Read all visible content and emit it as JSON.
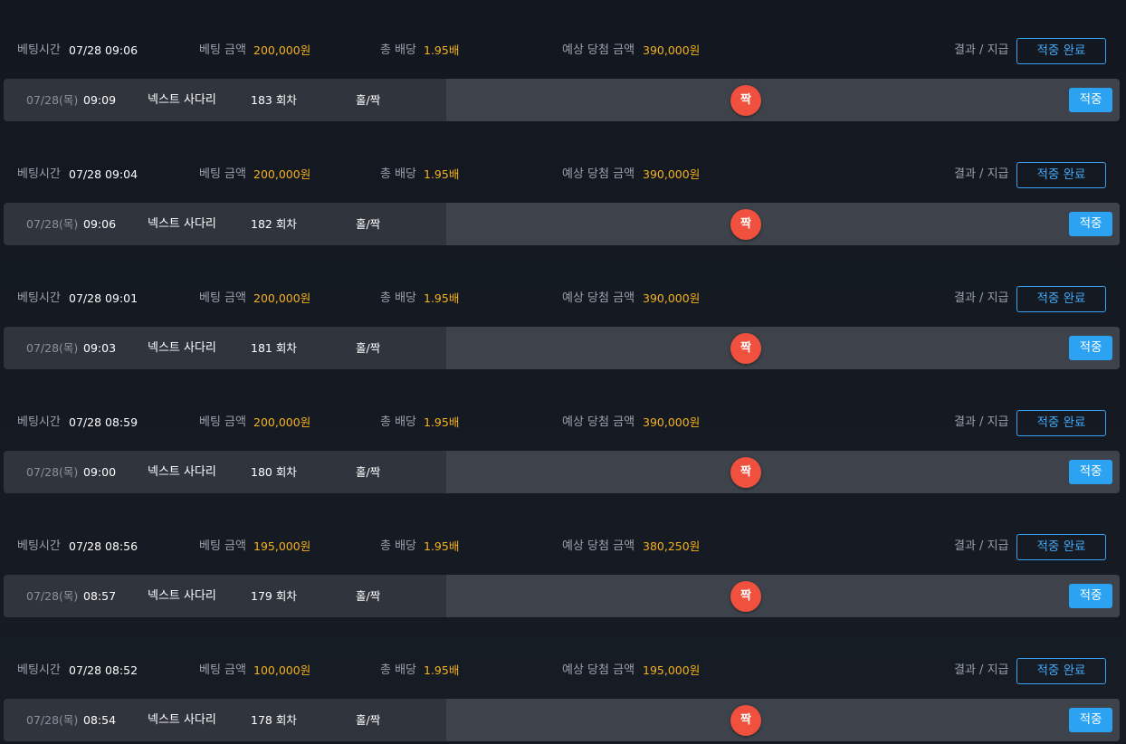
{
  "labels": {
    "bet_time": "베팅시간",
    "bet_amount": "베팅 금액",
    "total_odds": "총 배당",
    "expected_win": "예상 당첨 금액",
    "result_payout": "결과 / 지급"
  },
  "bets": [
    {
      "bet_time": "07/28 09:06",
      "amount": "200,000원",
      "odds": "1.95배",
      "expected": "390,000원",
      "status": "적중 완료",
      "detail": {
        "date": "07/28(목)",
        "time": "09:09",
        "game": "넥스트 사다리",
        "round": "183 회차",
        "market": "홀/짝",
        "pick": "짝",
        "result": "적중"
      }
    },
    {
      "bet_time": "07/28 09:04",
      "amount": "200,000원",
      "odds": "1.95배",
      "expected": "390,000원",
      "status": "적중 완료",
      "detail": {
        "date": "07/28(목)",
        "time": "09:06",
        "game": "넥스트 사다리",
        "round": "182 회차",
        "market": "홀/짝",
        "pick": "짝",
        "result": "적중"
      }
    },
    {
      "bet_time": "07/28 09:01",
      "amount": "200,000원",
      "odds": "1.95배",
      "expected": "390,000원",
      "status": "적중 완료",
      "detail": {
        "date": "07/28(목)",
        "time": "09:03",
        "game": "넥스트 사다리",
        "round": "181 회차",
        "market": "홀/짝",
        "pick": "짝",
        "result": "적중"
      }
    },
    {
      "bet_time": "07/28 08:59",
      "amount": "200,000원",
      "odds": "1.95배",
      "expected": "390,000원",
      "status": "적중 완료",
      "detail": {
        "date": "07/28(목)",
        "time": "09:00",
        "game": "넥스트 사다리",
        "round": "180 회차",
        "market": "홀/짝",
        "pick": "짝",
        "result": "적중"
      }
    },
    {
      "bet_time": "07/28 08:56",
      "amount": "195,000원",
      "odds": "1.95배",
      "expected": "380,250원",
      "status": "적중 완료",
      "detail": {
        "date": "07/28(목)",
        "time": "08:57",
        "game": "넥스트 사다리",
        "round": "179 회차",
        "market": "홀/짝",
        "pick": "짝",
        "result": "적중"
      }
    },
    {
      "bet_time": "07/28 08:52",
      "amount": "100,000원",
      "odds": "1.95배",
      "expected": "195,000원",
      "status": "적중 완료",
      "detail": {
        "date": "07/28(목)",
        "time": "08:54",
        "game": "넥스트 사다리",
        "round": "178 회차",
        "market": "홀/짝",
        "pick": "짝",
        "result": "적중"
      }
    }
  ],
  "colors": {
    "background": "#151a22",
    "label": "#9aa0aa",
    "gold": "#f5b21b",
    "accent_blue": "#2ba3f2",
    "ball_red": "#f0513e",
    "row_left": "#30353d",
    "row_right": "#3e434b"
  }
}
